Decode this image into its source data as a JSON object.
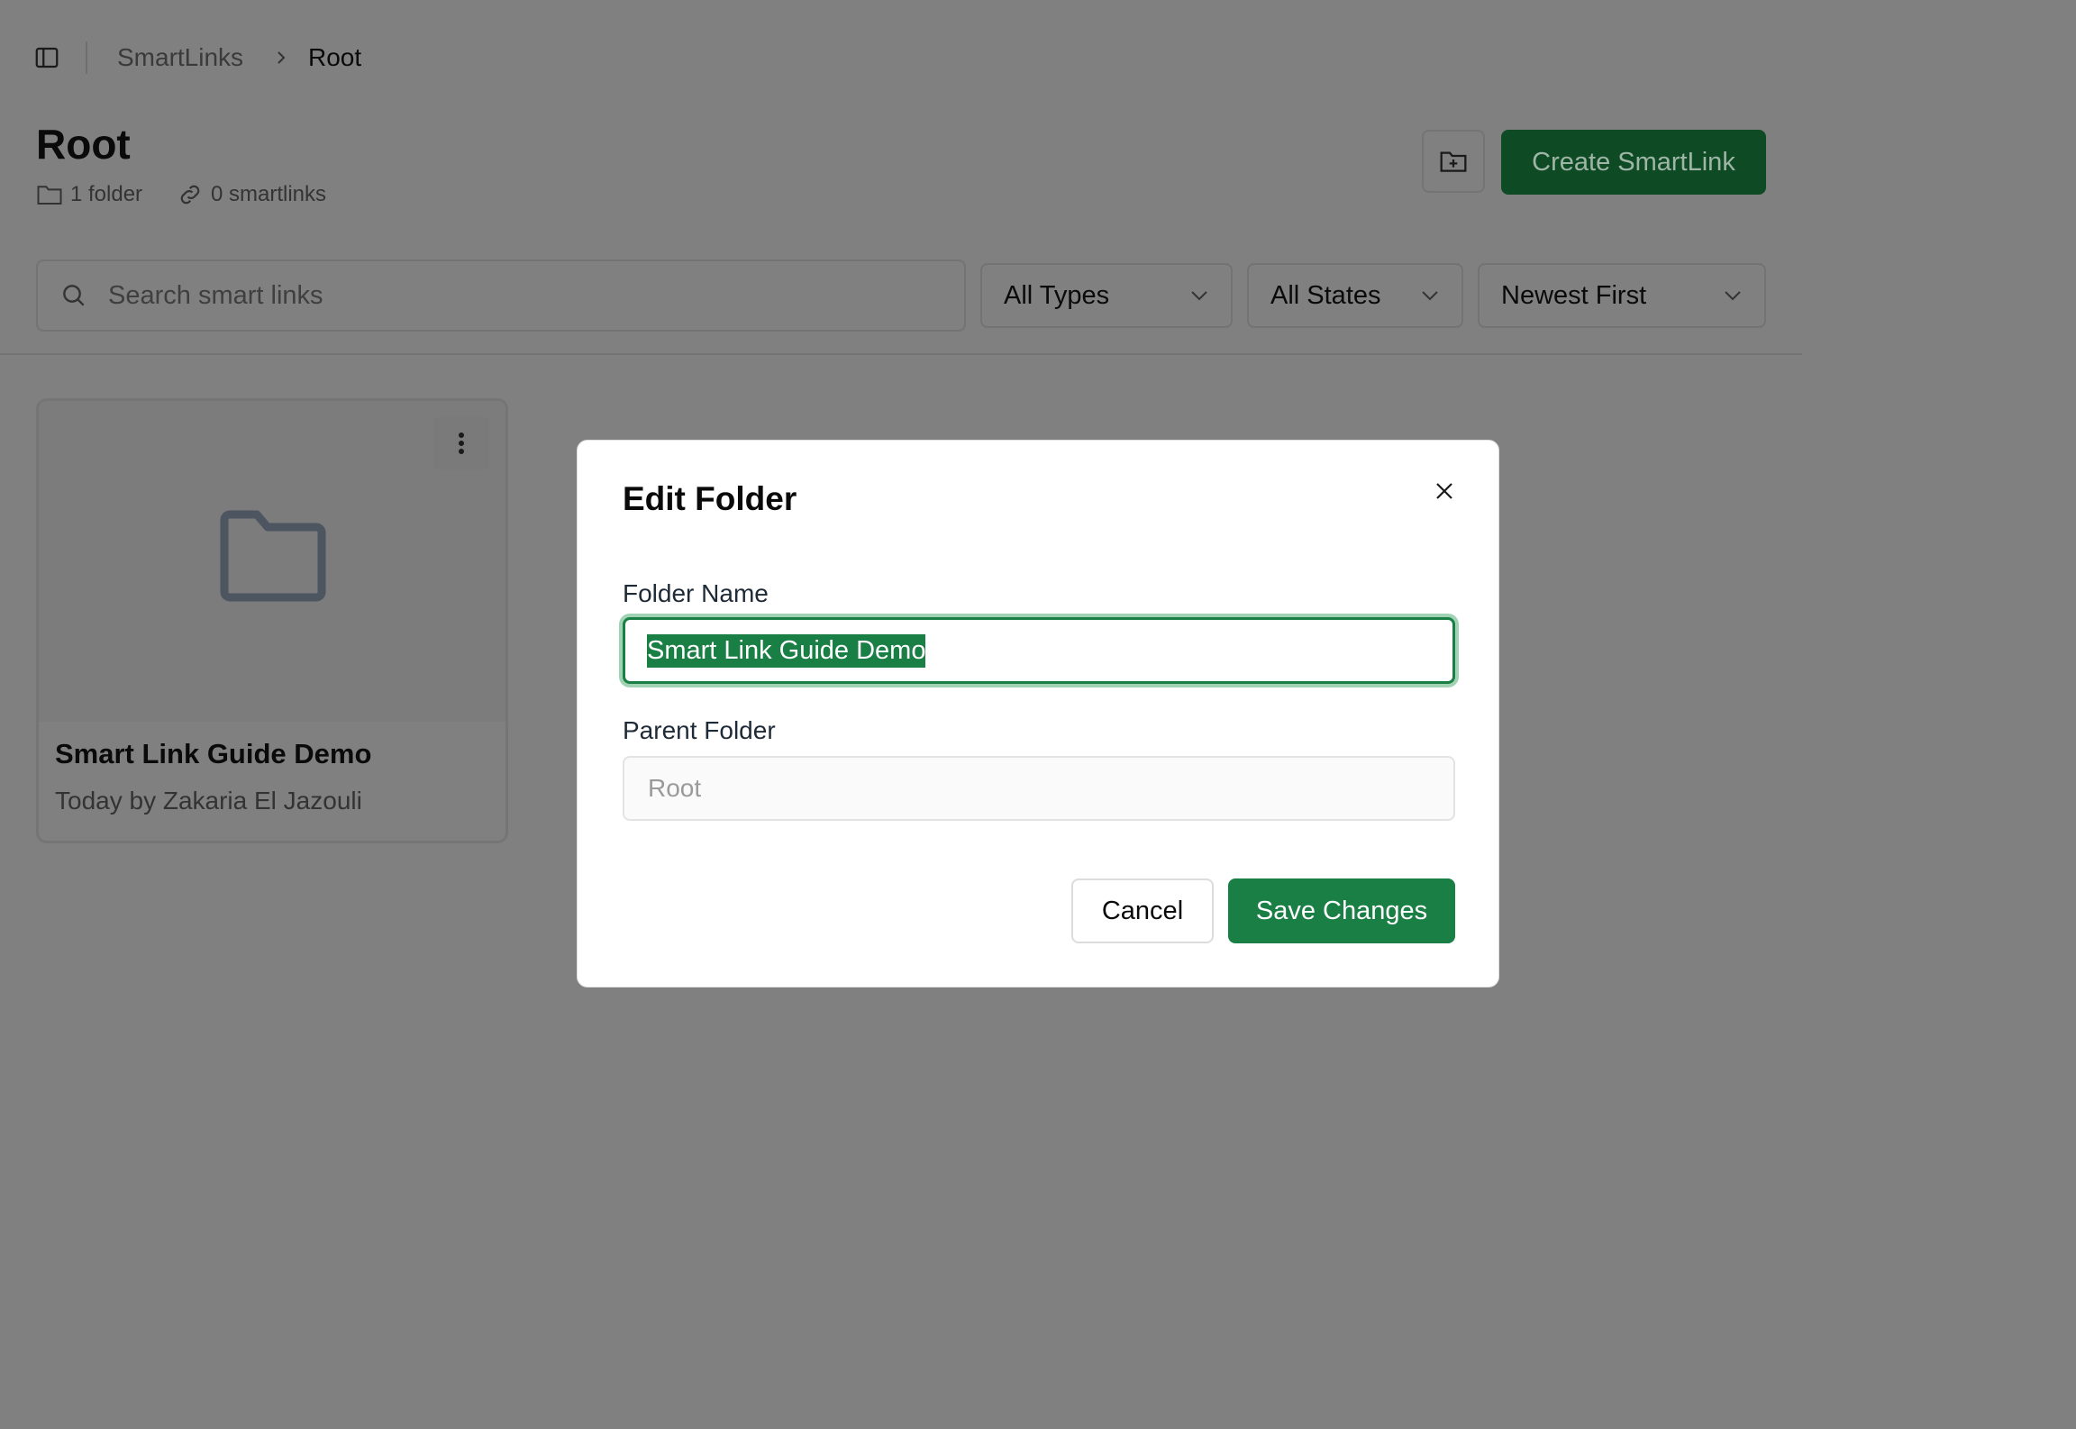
{
  "breadcrumb": {
    "parent": "SmartLinks",
    "current": "Root"
  },
  "header": {
    "title": "Root",
    "folder_count": "1 folder",
    "smartlink_count": "0 smartlinks",
    "create_button": "Create SmartLink"
  },
  "filters": {
    "search_placeholder": "Search smart links",
    "type": "All Types",
    "state": "All States",
    "sort": "Newest First"
  },
  "folders": [
    {
      "name": "Smart Link Guide Demo",
      "subtitle": "Today by Zakaria El Jazouli"
    }
  ],
  "modal": {
    "title": "Edit Folder",
    "folder_name_label": "Folder Name",
    "folder_name_value": "Smart Link Guide Demo",
    "parent_folder_label": "Parent Folder",
    "parent_folder_value": "Root",
    "cancel_label": "Cancel",
    "save_label": "Save Changes"
  },
  "colors": {
    "overlay": "#808080",
    "accent_green": "#1a7f45",
    "dark_green": "#0e4b24"
  },
  "icons": [
    "sidebar-toggle-icon",
    "chevron-right-icon",
    "folder-icon",
    "link-icon",
    "folder-plus-icon",
    "search-icon",
    "chevron-down-icon",
    "more-vertical-icon",
    "close-icon"
  ]
}
